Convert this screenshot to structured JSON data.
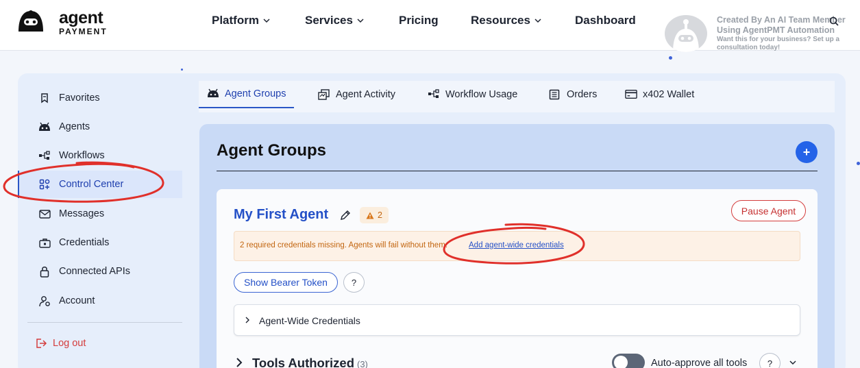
{
  "brand": {
    "name": "agent",
    "sub": "PAYMENT"
  },
  "nav": [
    {
      "label": "Platform",
      "dropdown": true
    },
    {
      "label": "Services",
      "dropdown": true
    },
    {
      "label": "Pricing",
      "dropdown": false
    },
    {
      "label": "Resources",
      "dropdown": true
    },
    {
      "label": "Dashboard",
      "dropdown": false
    }
  ],
  "promo": {
    "line1": "Created By An AI Team Member",
    "line2": "Using AgentPMT Automation",
    "line3": "Want this for your business? Set up a",
    "line4": "consultation today!"
  },
  "sidebar": {
    "items": [
      {
        "label": "Favorites",
        "icon": "bookmark-icon",
        "active": false
      },
      {
        "label": "Agents",
        "icon": "agent-icon",
        "active": false
      },
      {
        "label": "Workflows",
        "icon": "workflow-icon",
        "active": false
      },
      {
        "label": "Control Center",
        "icon": "grid-icon",
        "active": true
      },
      {
        "label": "Messages",
        "icon": "mail-icon",
        "active": false
      },
      {
        "label": "Credentials",
        "icon": "briefcase-icon",
        "active": false
      },
      {
        "label": "Connected APIs",
        "icon": "lock-icon",
        "active": false
      },
      {
        "label": "Account",
        "icon": "user-settings-icon",
        "active": false
      }
    ],
    "logout": "Log out"
  },
  "tabs": [
    {
      "label": "Agent Groups",
      "icon": "agent-icon",
      "active": true
    },
    {
      "label": "Agent Activity",
      "icon": "activity-icon",
      "active": false
    },
    {
      "label": "Workflow Usage",
      "icon": "workflow-icon",
      "active": false
    },
    {
      "label": "Orders",
      "icon": "orders-icon",
      "active": false
    },
    {
      "label": "x402 Wallet",
      "icon": "wallet-icon",
      "active": false
    }
  ],
  "main": {
    "title": "Agent Groups",
    "add_label": "+",
    "agent": {
      "name": "My First Agent",
      "warning_count": "2",
      "pause_label": "Pause Agent",
      "alert_text": "2 required credentials missing. Agents will fail without them.",
      "alert_link": "Add agent-wide credentials",
      "bearer_label": "Show Bearer Token",
      "help_label": "?",
      "credentials_section": "Agent-Wide Credentials",
      "tools_label": "Tools Authorized",
      "tools_count": "(3)",
      "auto_approve_label": "Auto-approve all tools",
      "auto_approve_on": false
    }
  },
  "colors": {
    "accent": "#2450c7",
    "warning": "#c2650f",
    "danger": "#d43c3c",
    "annotation": "#e0302a"
  }
}
